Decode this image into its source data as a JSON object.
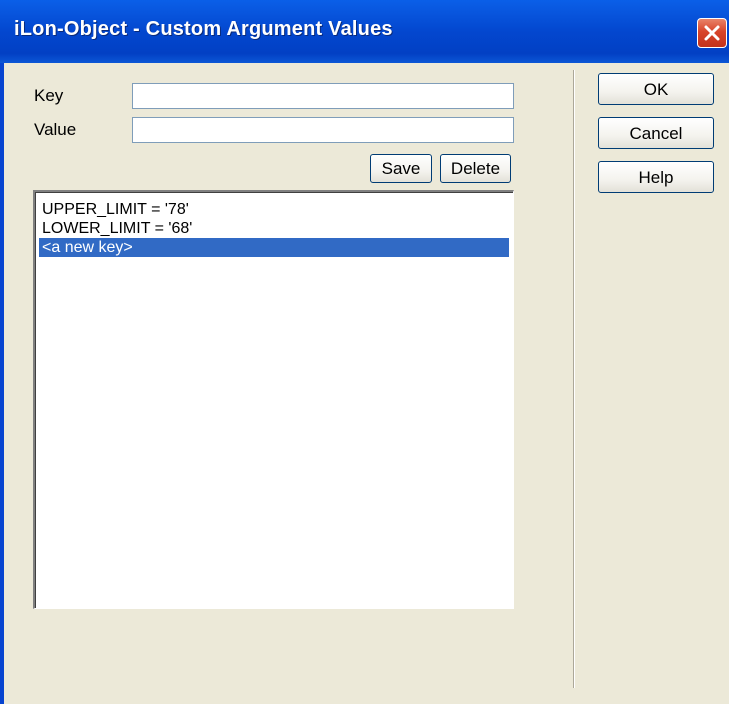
{
  "window": {
    "title": "iLon-Object - Custom Argument Values",
    "close_label": "Close"
  },
  "form": {
    "key_label": "Key",
    "key_value": "",
    "value_label": "Value",
    "value_value": "",
    "save_label": "Save",
    "delete_label": "Delete"
  },
  "list": {
    "items": [
      {
        "text": "UPPER_LIMIT = '78'",
        "selected": false
      },
      {
        "text": "LOWER_LIMIT = '68'",
        "selected": false
      },
      {
        "text": "<a new key>",
        "selected": true
      }
    ]
  },
  "actions": {
    "ok_label": "OK",
    "cancel_label": "Cancel",
    "help_label": "Help"
  },
  "colors": {
    "titlebar": "#0347cf",
    "selection": "#316ac5",
    "dialog_bg": "#ece9d8",
    "close_button": "#d8442a"
  },
  "icons": {
    "close": "close-x-icon"
  }
}
